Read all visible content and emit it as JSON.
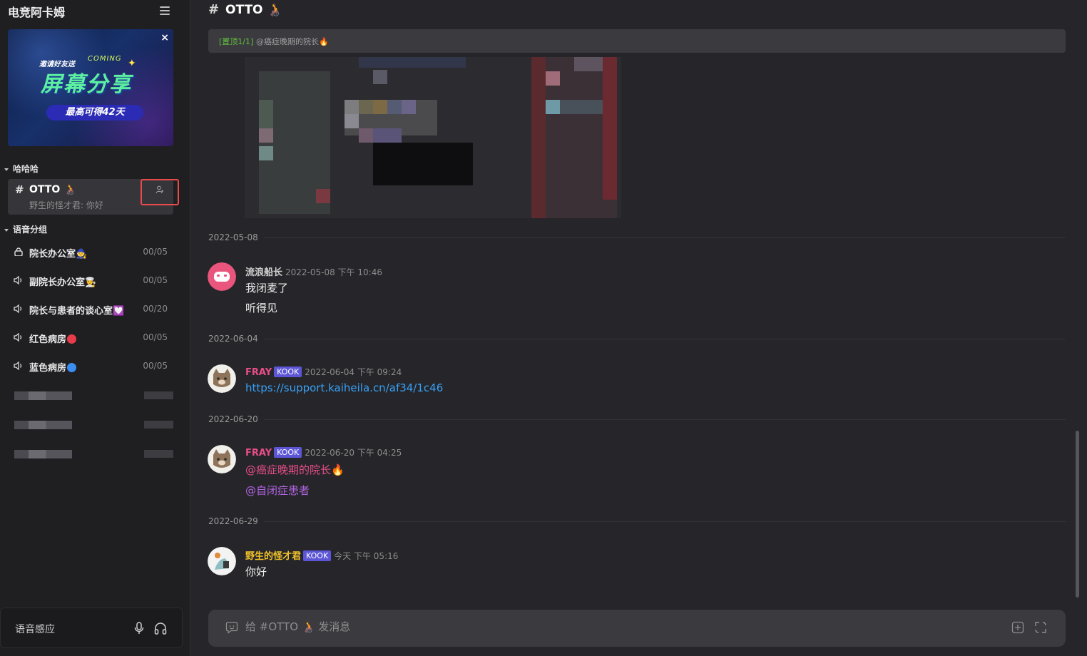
{
  "server": {
    "name": "电竞阿卡姆"
  },
  "banner": {
    "invite": "邀请好友送",
    "coming": "COMING",
    "title": "屏幕分享",
    "subtitle": "最高可得42天",
    "close": "×"
  },
  "categories": {
    "text": "哈哈哈",
    "voice": "语音分组"
  },
  "active_channel": {
    "name": "OTTO 🧑‍🦽",
    "preview": "野生的怪才君: 你好"
  },
  "voice_channels": [
    {
      "name": "院长办公室",
      "emoji": "🧙",
      "count": "00/05",
      "locked": true
    },
    {
      "name": "副院长办公室",
      "emoji": "👨‍🍳",
      "count": "00/05"
    },
    {
      "name": "院长与患者的谈心室",
      "emoji": "💟",
      "count": "00/20"
    },
    {
      "name": "红色病房",
      "count": "00/05",
      "color": "#e83c4b"
    },
    {
      "name": "蓝色病房",
      "count": "00/05",
      "color": "#3b8ef0"
    }
  ],
  "voice_status": {
    "label": "语音感应"
  },
  "header": {
    "hash": "#",
    "channel": "OTTO 🧑‍🦽"
  },
  "pinned": {
    "tag": "[置顶1/1]",
    "text": "@癌症晚期的院长🔥"
  },
  "dates": [
    "2022-05-08",
    "2022-06-04",
    "2022-06-20",
    "2022-06-29"
  ],
  "messages": [
    {
      "author": "流浪船长",
      "author_color": "#d0d0d0",
      "time": "2022-05-08 下午 10:46",
      "lines": [
        "我闭麦了",
        "听得见"
      ]
    },
    {
      "author": "FRAY",
      "author_color": "#e84d8a",
      "badge": "KOOK",
      "time": "2022-06-04 下午 09:24",
      "lines": [
        "https://support.kaiheila.cn/af34/1c46"
      ]
    },
    {
      "author": "FRAY",
      "author_color": "#e84d8a",
      "badge": "KOOK",
      "time": "2022-06-20 下午 04:25",
      "lines": [
        "@癌症晚期的院长🔥",
        "@自闭症患者"
      ]
    },
    {
      "author": "野生的怪才君",
      "author_color": "#f2c32a",
      "badge": "KOOK",
      "time": "今天 下午 05:16",
      "lines": [
        "你好"
      ]
    }
  ],
  "composer": {
    "placeholder": "给 #OTTO 🧑‍🦽 发消息"
  }
}
